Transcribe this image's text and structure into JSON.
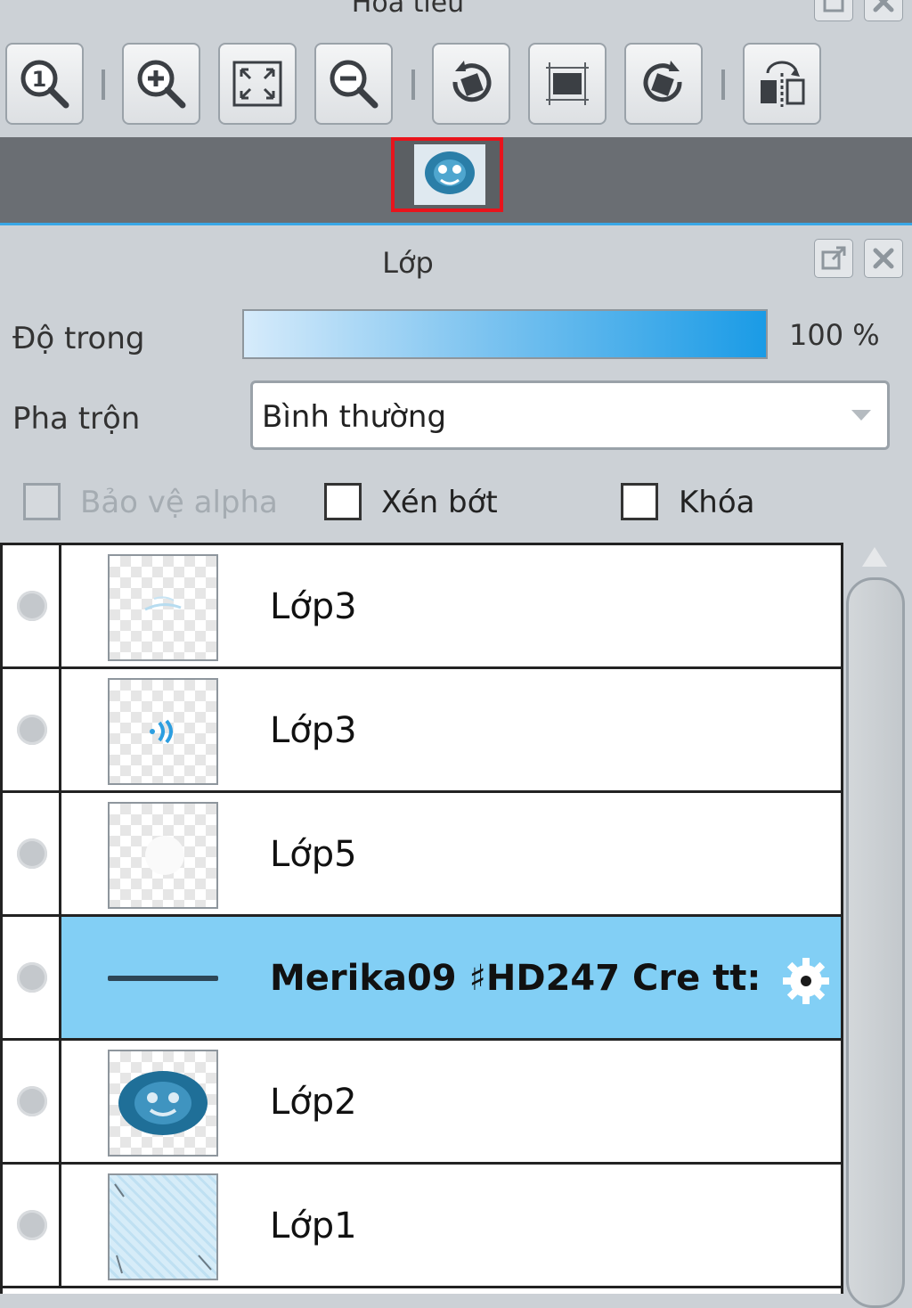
{
  "navigator": {
    "title": "Hoa tiêu",
    "toolbar": [
      {
        "name": "zoom-actual-icon"
      },
      {
        "name": "zoom-in-icon"
      },
      {
        "name": "fit-to-window-icon"
      },
      {
        "name": "zoom-out-icon"
      },
      {
        "name": "rotate-left-icon"
      },
      {
        "name": "reset-rotation-icon"
      },
      {
        "name": "rotate-right-icon"
      },
      {
        "name": "flip-horizontal-icon"
      }
    ]
  },
  "layers_panel": {
    "title": "Lớp",
    "opacity_label": "Độ trong",
    "opacity_value": "100 %",
    "opacity": 1.0,
    "blend_label": "Pha trộn",
    "blend_value": "Bình thường",
    "protect_alpha_label": "Bảo vệ alpha",
    "clipping_label": "Xén bớt",
    "lock_label": "Khóa",
    "layers": [
      {
        "name": "Lớp3",
        "selected": false
      },
      {
        "name": "Lớp3",
        "selected": false
      },
      {
        "name": "Lớp5",
        "selected": false
      },
      {
        "name": "Merika09 ♯HD247 Cre tt:",
        "selected": true
      },
      {
        "name": "Lớp2",
        "selected": false
      },
      {
        "name": "Lớp1",
        "selected": false
      }
    ]
  },
  "colors": {
    "accent": "#39a7e6",
    "selected_row": "#82cff5",
    "highlight_frame": "#e8141c"
  }
}
